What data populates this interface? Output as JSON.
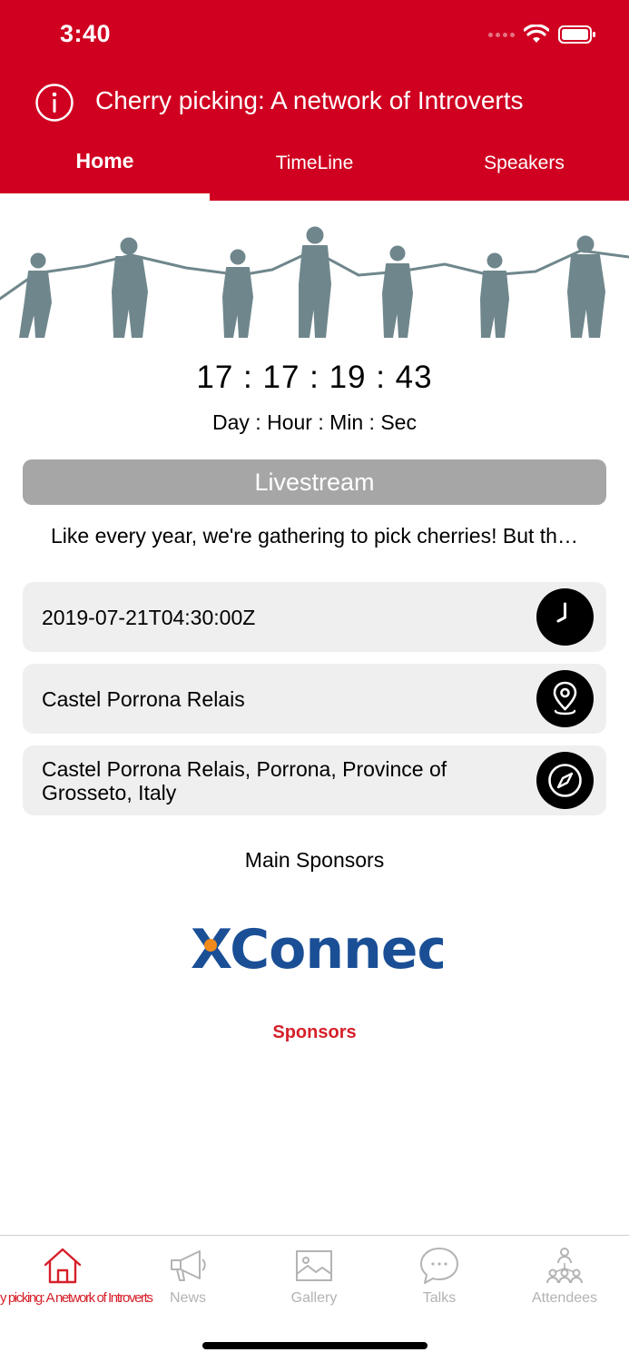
{
  "status_bar": {
    "time": "3:40"
  },
  "header": {
    "title": "Cherry picking: A network of Introverts"
  },
  "tabs": [
    {
      "label": "Home",
      "active": true
    },
    {
      "label": "TimeLine",
      "active": false
    },
    {
      "label": "Speakers",
      "active": false
    }
  ],
  "countdown": {
    "value": "17 : 17 : 19 : 43",
    "labels": "Day : Hour : Min : Sec"
  },
  "livestream": {
    "label": "Livestream"
  },
  "description": "Like every year, we're gathering to pick cherries! But th…",
  "details": {
    "datetime": "2019-07-21T04:30:00Z",
    "venue": "Castel Porrona Relais",
    "address": "Castel Porrona Relais, Porrona, Province of Grosseto, Italy"
  },
  "sponsors": {
    "heading": "Main Sponsors",
    "logo_text": "XConnect",
    "link_label": "Sponsors"
  },
  "bottom_nav": [
    {
      "label": "y picking: A network of Introverts",
      "icon": "home-icon",
      "active": true
    },
    {
      "label": "News",
      "icon": "megaphone-icon",
      "active": false
    },
    {
      "label": "Gallery",
      "icon": "image-icon",
      "active": false
    },
    {
      "label": "Talks",
      "icon": "chat-bubble-icon",
      "active": false
    },
    {
      "label": "Attendees",
      "icon": "people-icon",
      "active": false
    }
  ],
  "colors": {
    "brand_red": "#cf0020",
    "accent_red": "#d6202a",
    "row_bg": "#efefef",
    "button_gray": "#a6a6a6",
    "inactive_nav": "#b3b3b3"
  }
}
